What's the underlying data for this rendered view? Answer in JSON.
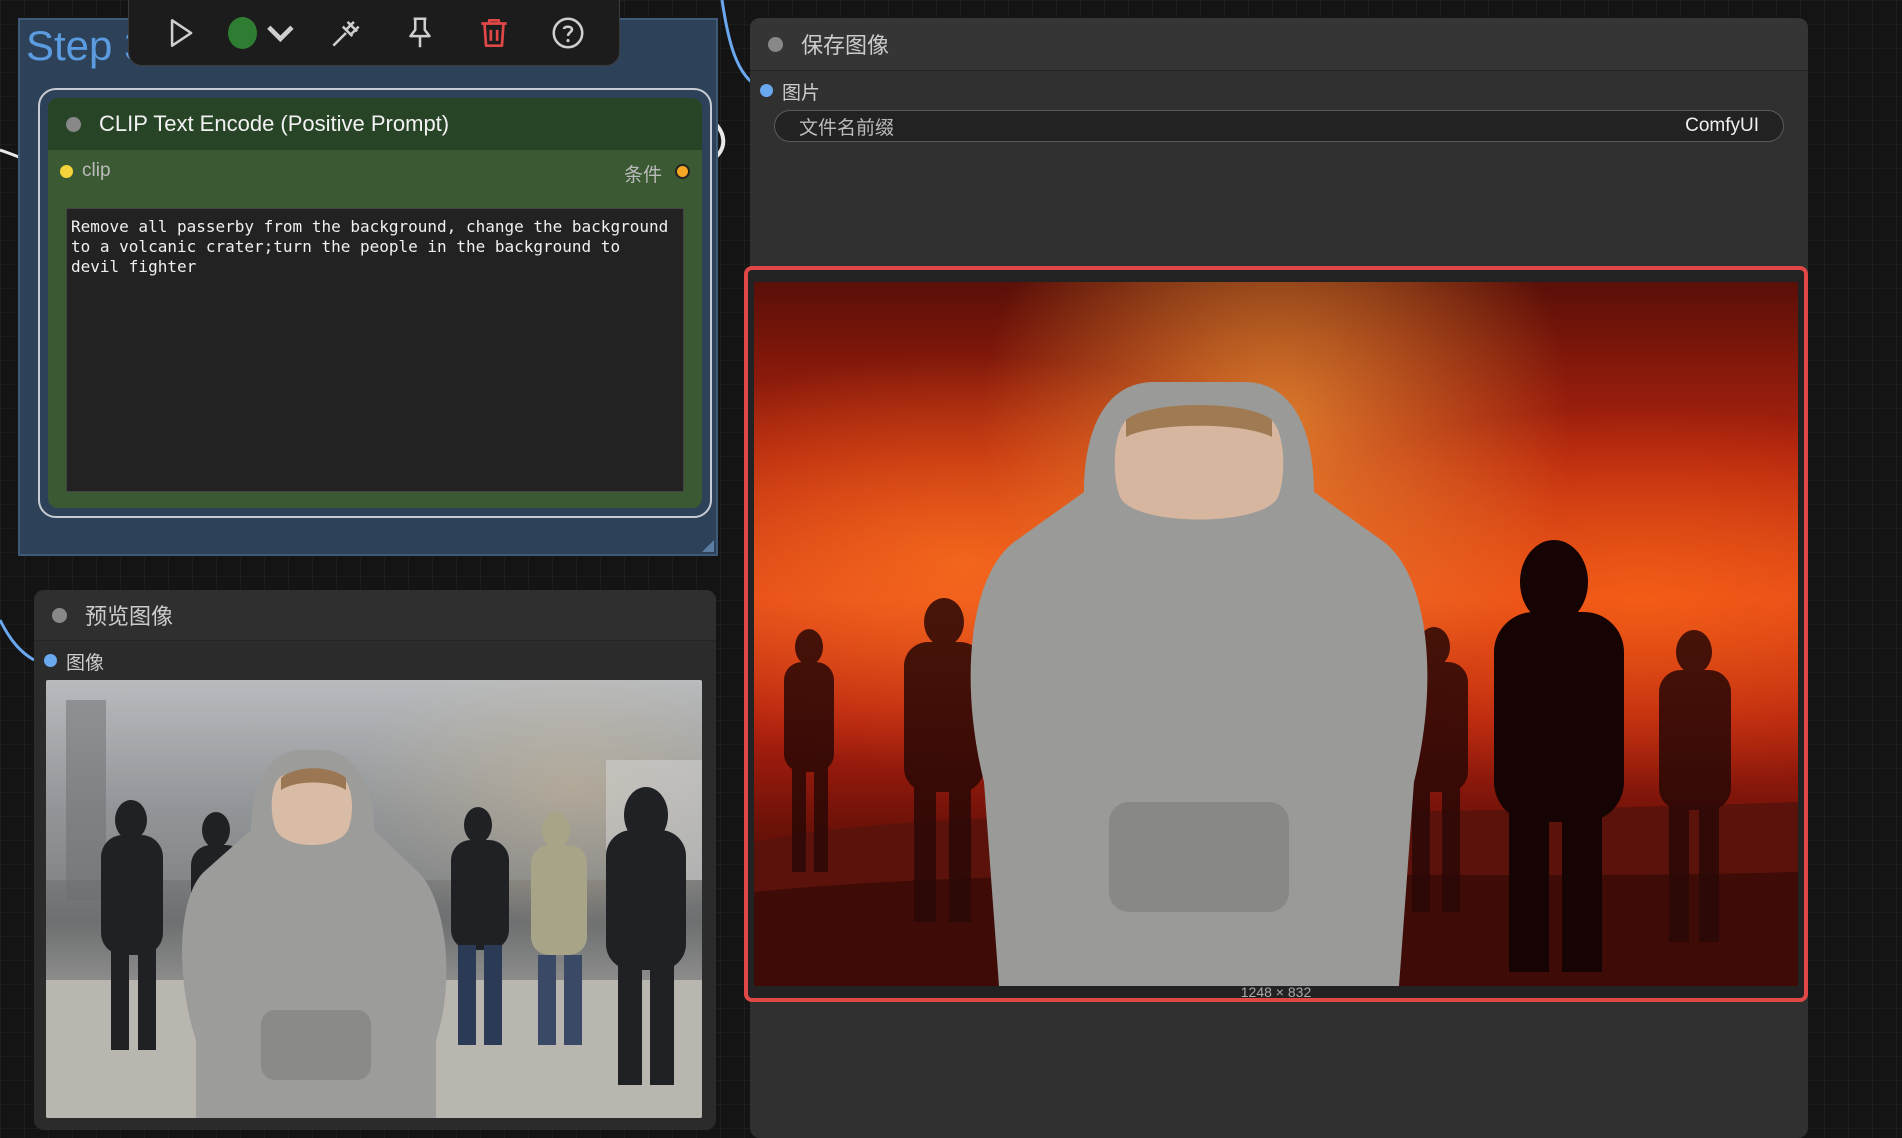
{
  "group": {
    "title": "Step 3"
  },
  "toolbar": {
    "run_icon": "play-icon",
    "color_icon": "color-dot-icon",
    "bypass_icon": "bypass-icon",
    "pin_icon": "pin-icon",
    "delete_icon": "trash-icon",
    "help_icon": "help-icon",
    "accent": "#2e7d32",
    "delete_color": "#e04848"
  },
  "clip_node": {
    "title": "CLIP Text Encode (Positive Prompt)",
    "input_label": "clip",
    "output_label": "条件",
    "prompt": "Remove all passerby from the background, change the background\nto a volcanic crater;turn the people in the background to\ndevil fighter"
  },
  "preview_node": {
    "title": "预览图像",
    "slot_label": "图像"
  },
  "save_node": {
    "title": "保存图像",
    "slot_label": "图片",
    "field_label": "文件名前缀",
    "field_value": "ComfyUI",
    "dims": "1248 × 832"
  },
  "colors": {
    "selected_border": "#e04848",
    "clip_slot": "#f5d33a",
    "cond_slot": "#f5a623",
    "image_slot": "#6aa8f0"
  }
}
